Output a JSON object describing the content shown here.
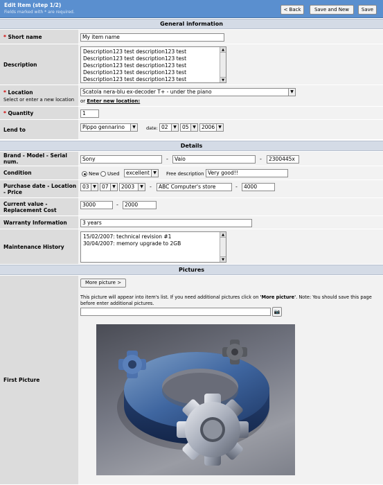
{
  "header": {
    "title": "Edit Item   (step 1/2)",
    "note": "Fields marked with * are required.",
    "back": "< Back",
    "save_new": "Save and New",
    "save": "Save"
  },
  "sections": {
    "general": "General information",
    "details": "Details",
    "pictures": "Pictures"
  },
  "fields": {
    "short_name": {
      "label": "Short name",
      "value": "My item name"
    },
    "description": {
      "label": "Description",
      "lines": [
        "Description123 test description123 test",
        "Description123 test description123 test",
        "Description123 test description123 test",
        "Description123 test description123 test",
        "Description123 test description123 test"
      ]
    },
    "location": {
      "label": "Location",
      "sub": "Select or enter a new location",
      "value": "Scatola nera-blu ex-decoder T+ - under the piano",
      "or": "or",
      "link": "Enter new location:"
    },
    "quantity": {
      "label": "Quantity",
      "value": "1"
    },
    "lend_to": {
      "label": "Lend to",
      "person": "Pippo gennarino",
      "date_label": "date:",
      "day": "02",
      "month": "05",
      "year": "2006"
    },
    "brand": {
      "label": "Brand - Model - Serial num.",
      "brand": "Sony",
      "model": "Vaio",
      "serial": "2300445x"
    },
    "condition": {
      "label": "Condition",
      "new": "New",
      "used": "Used",
      "grade": "excellent",
      "free_label": "Free description",
      "free_value": "Very good!!"
    },
    "purchase": {
      "label": "Purchase date - Location - Price",
      "day": "03",
      "month": "07",
      "year": "2003",
      "location": "ABC Computer's store",
      "price": "4000"
    },
    "value": {
      "label": "Current value - Replacement Cost",
      "current": "3000",
      "replacement": "2000"
    },
    "warranty": {
      "label": "Warranty Information",
      "value": "3 years"
    },
    "maintenance": {
      "label": "Maintenance History",
      "lines": [
        "15/02/2007: technical revision #1",
        "30/04/2007: memory upgrade to 2GB"
      ]
    },
    "picture": {
      "label": "First Picture",
      "more": "More picture >",
      "info1": "This picture will appear into item's list.    If you need additional pictures click on ",
      "info_bold": "'More picture'",
      "info2": ". Note: You should save this page",
      "info3": "before enter additional pictures."
    }
  },
  "separators": {
    "dash": "-"
  },
  "colors": {
    "header": "#5a8fcf",
    "section": "#d4dbe6",
    "label_bg": "#dcdcdc",
    "field_bg": "#f2f2f2",
    "required": "#d00000"
  }
}
